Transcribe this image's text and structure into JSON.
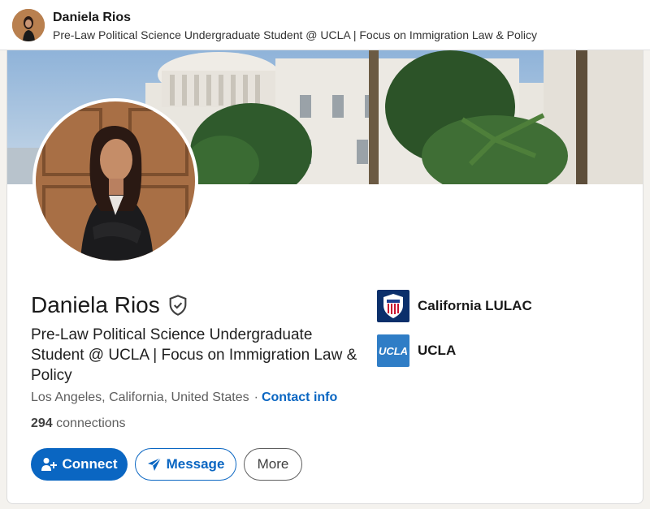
{
  "topbar": {
    "name": "Daniela Rios",
    "headline": "Pre-Law Political Science Undergraduate Student @ UCLA | Focus on Immigration Law & Policy"
  },
  "profile": {
    "name": "Daniela Rios",
    "verified_icon": "verified-shield-icon",
    "headline": "Pre-Law Political Science Undergraduate Student @ UCLA | Focus on Immigration Law & Policy",
    "location": "Los Angeles, California, United States",
    "separator": "·",
    "contact_info": "Contact info",
    "connections_count": "294",
    "connections_label": " connections"
  },
  "actions": {
    "connect": "Connect",
    "message": "Message",
    "more": "More"
  },
  "organizations": [
    {
      "name": "California LULAC",
      "logo": "lulac-logo"
    },
    {
      "name": "UCLA",
      "logo_text": "UCLA"
    }
  ],
  "colors": {
    "primary": "#0a66c2",
    "text": "#191919",
    "muted": "#5e5e5e"
  }
}
